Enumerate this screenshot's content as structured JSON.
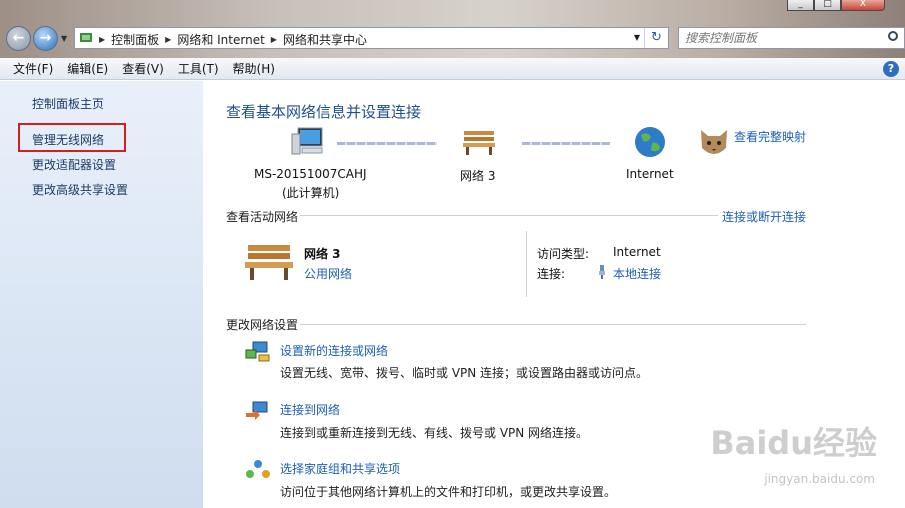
{
  "window": {
    "min": "_",
    "max": "□",
    "close": "X"
  },
  "address": {
    "crumbs": [
      "控制面板",
      "网络和 Internet",
      "网络和共享中心"
    ],
    "search_placeholder": "搜索控制面板"
  },
  "menu": [
    "文件(F)",
    "编辑(E)",
    "查看(V)",
    "工具(T)",
    "帮助(H)"
  ],
  "sidebar": {
    "items": [
      {
        "label": "控制面板主页"
      },
      {
        "label": "管理无线网络"
      },
      {
        "label": "更改适配器设置"
      },
      {
        "label": "更改高级共享设置"
      }
    ]
  },
  "main": {
    "title": "查看基本网络信息并设置连接",
    "full_map": "查看完整映射",
    "nodes": {
      "computer_name": "MS-20151007CAHJ",
      "computer_sub": "(此计算机)",
      "network": "网络  3",
      "internet": "Internet"
    },
    "active": {
      "heading": "查看活动网络",
      "connect_link": "连接或断开连接",
      "network_name": "网络  3",
      "network_type": "公用网络",
      "access_label": "访问类型:",
      "access_value": "Internet",
      "conn_label": "连接:",
      "conn_value": "本地连接"
    },
    "change": {
      "heading": "更改网络设置",
      "tasks": [
        {
          "title": "设置新的连接或网络",
          "desc": "设置无线、宽带、拨号、临时或 VPN 连接；或设置路由器或访问点。"
        },
        {
          "title": "连接到网络",
          "desc": "连接到或重新连接到无线、有线、拨号或 VPN 网络连接。"
        },
        {
          "title": "选择家庭组和共享选项",
          "desc": "访问位于其他网络计算机上的文件和打印机，或更改共享设置。"
        }
      ]
    }
  },
  "watermark": {
    "logo": "Baidu经验",
    "url": "jingyan.baidu.com"
  }
}
